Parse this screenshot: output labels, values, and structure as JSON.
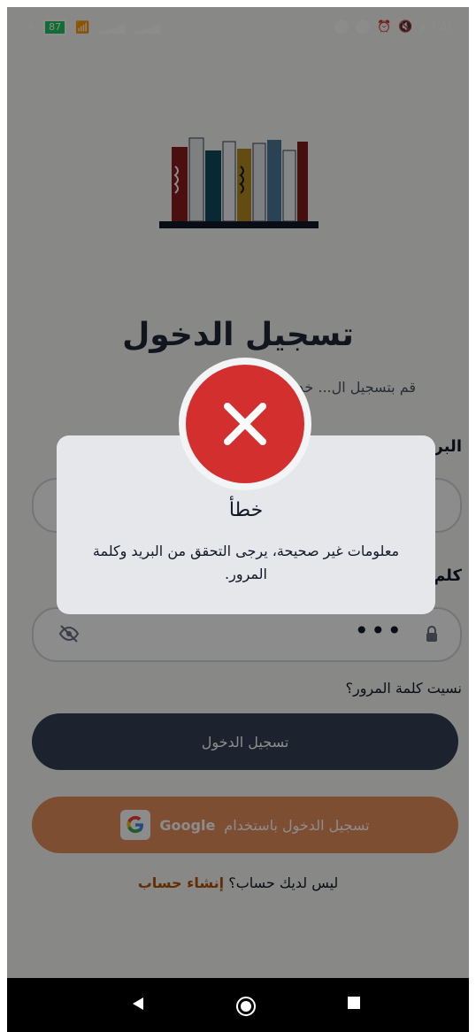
{
  "status_bar": {
    "battery": "87",
    "time": "١:٥٤ م"
  },
  "login": {
    "title": "تسجيل الدخول",
    "subtitle": "قم بتسجيل ال... خدام التطبيق",
    "email_label": "البر",
    "password_label": "كلم",
    "password_value": "•••",
    "forgot": "نسيت كلمة المرور؟",
    "login_button": "تسجيل الدخول",
    "google_button_prefix": "تسجيل الدخول باستخدام",
    "google_button_brand": "Google",
    "signup_prompt": "ليس لديك حساب؟",
    "signup_link": "إنشاء حساب"
  },
  "dialog": {
    "title": "خطأ",
    "message": "معلومات غير صحيحة، يرجى التحقق من البريد وكلمة المرور."
  },
  "colors": {
    "primary_button": "#334155",
    "google_button": "#e58f5b",
    "error_red": "#d32f2f",
    "link": "#b45309"
  }
}
